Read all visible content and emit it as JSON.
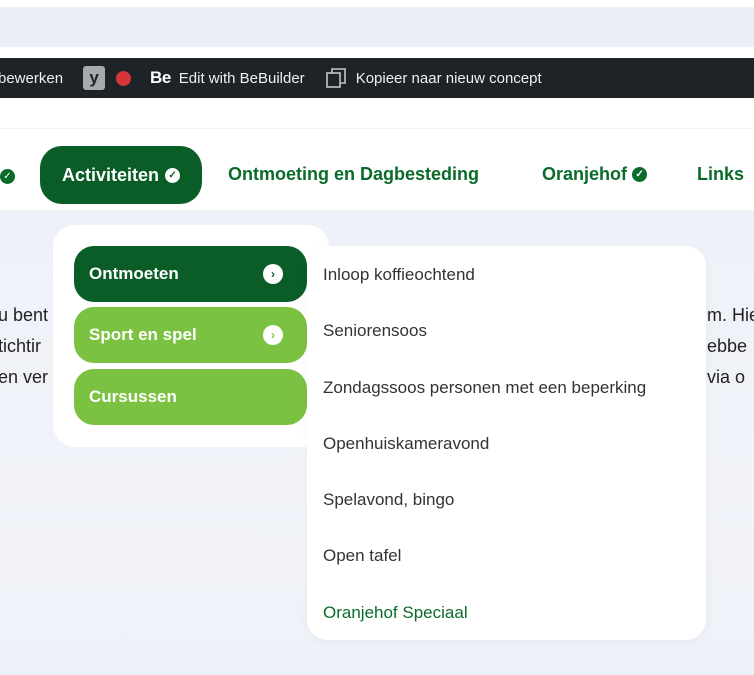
{
  "admin_bar": {
    "edit_label": "bewerken",
    "yoast_icon": "y",
    "bebuilder_logo": "Be",
    "bebuilder_label": "Edit with BeBuilder",
    "copy_label": "Kopieer naar nieuw concept"
  },
  "nav": {
    "items": [
      {
        "label": "Activiteiten",
        "active": true
      },
      {
        "label": "Ontmoeting en Dagbesteding"
      },
      {
        "label": "Oranjehof"
      },
      {
        "label": "Links"
      }
    ]
  },
  "background_text": {
    "left": [
      "u bent",
      "tichtir",
      "en ver"
    ],
    "right": [
      "m. Hie",
      "ebbe",
      "via o"
    ]
  },
  "submenu": {
    "categories": [
      {
        "label": "Ontmoeten",
        "has_children": true
      },
      {
        "label": "Sport en spel",
        "has_children": true
      },
      {
        "label": "Cursussen",
        "has_children": false
      }
    ],
    "links": [
      "Inloop koffieochtend",
      "Seniorensoos",
      "Zondagssoos personen met een beperking",
      "Openhuiskameravond",
      "Spelavond, bingo",
      "Open tafel",
      "Oranjehof Speciaal"
    ]
  },
  "colors": {
    "dark_green": "#0a5d26",
    "light_green": "#7bc142",
    "admin_bar": "#1d2327"
  },
  "icons": {
    "chevron": "chevron-down-icon",
    "arrow": "chevron-right-icon"
  }
}
